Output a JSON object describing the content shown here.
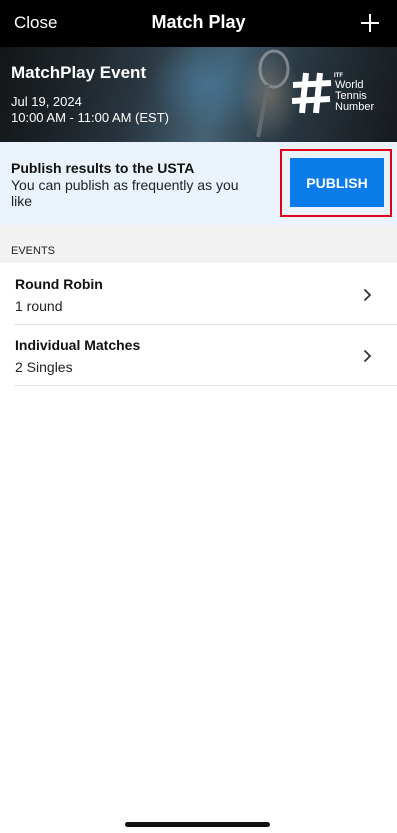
{
  "navbar": {
    "close_label": "Close",
    "title": "Match Play"
  },
  "hero": {
    "event_name": "MatchPlay Event",
    "date": "Jul 19, 2024",
    "time": "10:00 AM - 11:00 AM (EST)",
    "logo": {
      "itf": "ITF",
      "line1": "World",
      "line2": "Tennis",
      "line3": "Number"
    }
  },
  "publish": {
    "title": "Publish results to the USTA",
    "description": "You can publish as frequently as you like",
    "button_label": "PUBLISH",
    "highlight_color": "#e3001b",
    "button_color": "#0a7be8"
  },
  "events": {
    "section_label": "EVENTS",
    "items": [
      {
        "title": "Round Robin",
        "subtitle": "1 round"
      },
      {
        "title": "Individual Matches",
        "subtitle": "2 Singles"
      }
    ]
  }
}
